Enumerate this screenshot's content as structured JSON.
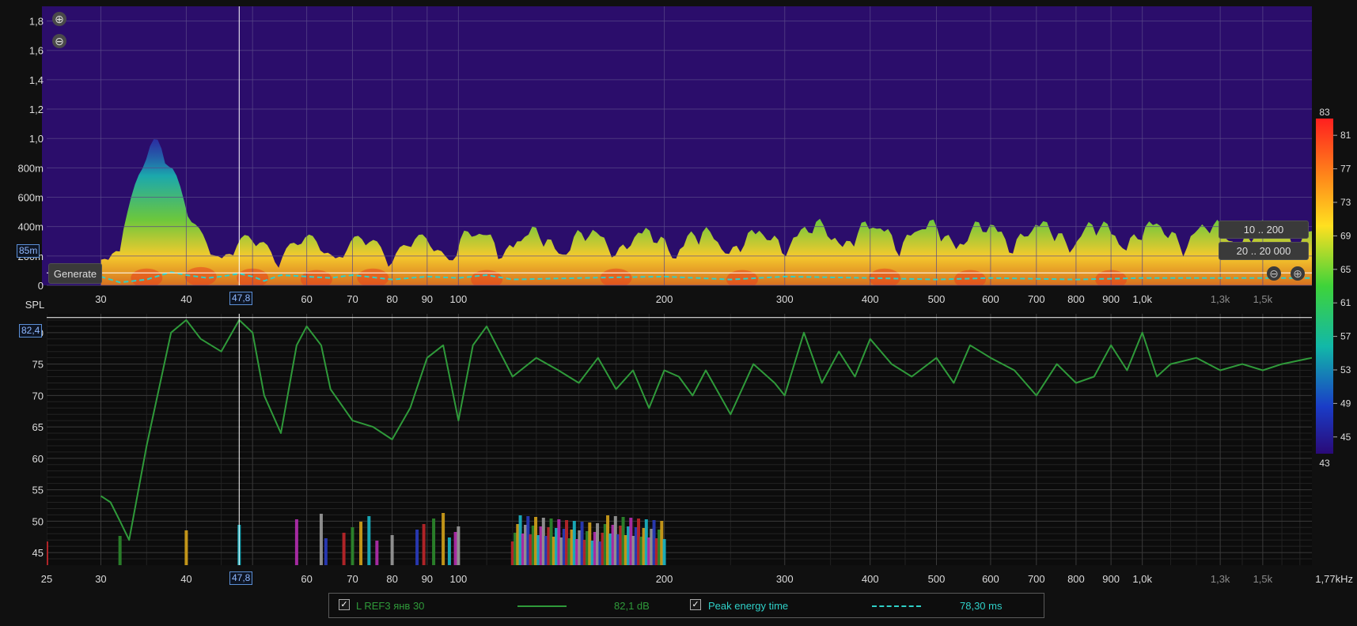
{
  "colors": {
    "background": "#101010",
    "plot_bg": "#0c0c0c",
    "spectrogram_bg": "#2b0d6b",
    "grid": "#3a3a3a",
    "grid_spectro": "#5a4a8a",
    "axis_text": "#dcdcdc",
    "spl_line": "#2f9a3a",
    "peak_line": "#2fd0c8",
    "cursor": "#ffffff",
    "cursor_label": "#8fb8ff"
  },
  "spectrogram": {
    "y_ticks": [
      "1,8",
      "1,6",
      "1,4",
      "1,2",
      "1,0",
      "800m",
      "600m",
      "400m",
      "200m",
      "0"
    ],
    "time_cursor_label": "85m",
    "generate_label": "Generate",
    "zoom_in_icon": "zoom-in-icon",
    "zoom_out_icon": "zoom-out-icon",
    "range_buttons": [
      "10 .. 200",
      "20 .. 20 000"
    ],
    "x_ticks": [
      "30",
      "40",
      "",
      "60",
      "70",
      "80",
      "90",
      "100",
      "200",
      "300",
      "400",
      "500",
      "600",
      "700",
      "800",
      "900",
      "1,0k",
      "1,3k",
      "1,5k"
    ],
    "freq_cursor_label": "47,8"
  },
  "color_scale": {
    "top_label": "83",
    "bottom_label": "43",
    "ticks": [
      "81",
      "77",
      "73",
      "69",
      "65",
      "61",
      "57",
      "53",
      "49",
      "45"
    ]
  },
  "spl": {
    "y_label": "SPL",
    "y_ticks": [
      "80",
      "75",
      "70",
      "65",
      "60",
      "55",
      "50",
      "45"
    ],
    "level_cursor_label": "82,4",
    "x_ticks": [
      "25",
      "30",
      "40",
      "",
      "60",
      "70",
      "80",
      "90",
      "100",
      "200",
      "300",
      "400",
      "500",
      "600",
      "700",
      "800",
      "900",
      "1,0k",
      "1,3k",
      "1,5k",
      "1,77kHz"
    ],
    "freq_cursor_label": "47,8"
  },
  "legend": {
    "series1_name": "L REF3 янв 30",
    "series1_value": "82,1 dB",
    "series2_name": "Peak energy time",
    "series2_value": "78,30 ms",
    "check_mark": "✓"
  },
  "chart_data": [
    {
      "type": "heatmap",
      "x_scale": "log",
      "x_range_hz": [
        25,
        1770
      ],
      "y_range_s": [
        0,
        1.9
      ],
      "z_range_db": [
        43,
        83
      ],
      "y_ticks": [
        "1,8",
        "1,6",
        "1,4",
        "1,2",
        "1,0",
        "800m",
        "600m",
        "400m",
        "200m",
        "0"
      ],
      "x_ticks": [
        "30",
        "40",
        "60",
        "70",
        "80",
        "90",
        "100",
        "200",
        "300",
        "400",
        "500",
        "600",
        "700",
        "800",
        "900",
        "1,0k",
        "1,3k",
        "1,5k"
      ],
      "series": [
        {
          "name": "Peak energy time",
          "x": [
            30,
            32,
            35,
            38,
            40,
            43,
            45,
            47.8,
            50,
            52,
            55,
            60,
            65,
            70,
            80,
            90,
            100,
            110,
            120,
            150,
            200,
            250,
            300,
            400,
            500,
            600,
            800,
            1000,
            1300,
            1770
          ],
          "y": [
            0.06,
            0.02,
            0.04,
            0.09,
            0.07,
            0.05,
            0.06,
            0.08,
            0.06,
            0.03,
            0.07,
            0.06,
            0.05,
            0.07,
            0.04,
            0.06,
            0.05,
            0.07,
            0.04,
            0.05,
            0.06,
            0.04,
            0.06,
            0.05,
            0.04,
            0.05,
            0.04,
            0.05,
            0.05,
            0.05
          ]
        }
      ]
    },
    {
      "type": "line",
      "x_scale": "log",
      "xlabel": "",
      "ylabel": "SPL",
      "xlim": [
        25,
        1770
      ],
      "ylim": [
        43,
        83
      ],
      "series": [
        {
          "name": "L REF3 янв 30",
          "x": [
            30,
            31,
            32,
            33,
            35,
            38,
            40,
            42,
            45,
            47.8,
            50,
            52,
            55,
            58,
            60,
            63,
            65,
            70,
            75,
            80,
            85,
            90,
            95,
            100,
            105,
            110,
            120,
            130,
            140,
            150,
            160,
            170,
            180,
            190,
            200,
            210,
            220,
            230,
            250,
            270,
            290,
            300,
            320,
            340,
            360,
            380,
            400,
            430,
            460,
            500,
            530,
            560,
            600,
            650,
            700,
            750,
            800,
            850,
            900,
            950,
            1000,
            1050,
            1100,
            1200,
            1300,
            1400,
            1500,
            1600,
            1770
          ],
          "y": [
            54,
            53,
            50,
            47,
            62,
            80,
            82,
            79,
            77,
            82,
            80,
            70,
            64,
            78,
            81,
            78,
            71,
            66,
            65,
            63,
            68,
            76,
            78,
            66,
            78,
            81,
            73,
            76,
            74,
            72,
            76,
            71,
            74,
            68,
            74,
            73,
            70,
            74,
            67,
            75,
            72,
            70,
            80,
            72,
            77,
            73,
            79,
            75,
            73,
            76,
            72,
            78,
            76,
            74,
            70,
            75,
            72,
            73,
            78,
            74,
            80,
            73,
            75,
            76,
            74,
            75,
            74,
            75,
            76
          ]
        }
      ]
    }
  ]
}
